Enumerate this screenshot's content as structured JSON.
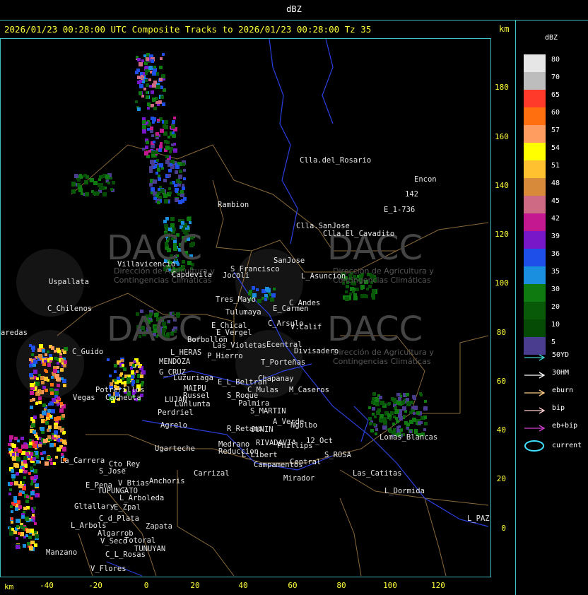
{
  "window": {
    "title": "dBZ"
  },
  "header": {
    "title": "2026/01/23 00:28:00 UTC Composite Tracks to 2026/01/23 00:28:00 Tz 35",
    "units_right": "km"
  },
  "map": {
    "x_axis_unit": "km",
    "x_ticks": [
      "-40",
      "-20",
      "0",
      "20",
      "40",
      "60",
      "80",
      "100",
      "120"
    ],
    "y_ticks": [
      "180",
      "160",
      "140",
      "120",
      "100",
      "80",
      "60",
      "40",
      "20",
      "0"
    ],
    "watermark": "DACC",
    "watermark_sub": "Dirección de Agricultura y Contingencias Climáticas",
    "places": [
      "Clla.del_Rosario",
      "Encon",
      "142",
      "E_1-736",
      "Rambion",
      "Clla.SanJose",
      "Clla.El_Cavadito",
      "S_Francisco",
      "SanJose",
      "L_Asuncion",
      "Uspallata",
      "Villavicencio",
      "Capdevila",
      "Jocoli",
      "Tres_Mayo",
      "Tulumaya",
      "E_Carmen",
      "C_Andes",
      "C_Chilenos",
      "E_Chical",
      "E_Vergel",
      "C_Arsulo",
      "V.Calif",
      "Borbollon",
      "Ecentral",
      "Divisadero",
      "L_HERAS",
      "P_Hierro",
      "Las_Violetas",
      "T_Porteñas",
      "C_Guido",
      "MENDOZA",
      "G_CRUZ",
      "Luzuriaga",
      "E_L_Beltran",
      "Chapanay",
      "MAIPU",
      "C_Mulas",
      "M_Caseros",
      "Potrerillos",
      "Russel",
      "S_Roque",
      "Vegas",
      "Cacheuta",
      "LUJAN",
      "Palmira",
      "Lunlunta",
      "Perdriel",
      "S_MARTIN",
      "A_Verde",
      "Agrelo",
      "R_Retamo",
      "JUNIN",
      "Ngolbo",
      "Lomas_Blancas",
      "Ugarteche",
      "Medrano",
      "RIVADAVIA",
      "12_Oct",
      "Phillips",
      "Reduccion",
      "L_Libert",
      "S_ROSA",
      "La_Carrera",
      "Cto_Rey",
      "Campamentos",
      "Central",
      "S_Jose",
      "Carrizal",
      "Las_Catitas",
      "E_Pena",
      "V_Btias",
      "Anchoris",
      "Mirador",
      "TUPUNGATO",
      "L_Dormida",
      "L_Arboleda",
      "Gltallary",
      "E_Zpal",
      "C_d_Plata",
      "L_PAZ",
      "L_Arbols",
      "Zapata",
      "Algarrob",
      "V_Seco",
      "Totoral",
      "TUNUYAN",
      "Manzano",
      "C_L_Rosas",
      "V_Flores",
      "aredas"
    ]
  },
  "legend": {
    "title": "dBZ",
    "levels": [
      {
        "value": "80",
        "color": "#e6e6e6"
      },
      {
        "value": "70",
        "color": "#bdbdbd"
      },
      {
        "value": "65",
        "color": "#ff3a2a"
      },
      {
        "value": "60",
        "color": "#ff6f10"
      },
      {
        "value": "57",
        "color": "#ff9d60"
      },
      {
        "value": "54",
        "color": "#ffff00"
      },
      {
        "value": "51",
        "color": "#ffc12f"
      },
      {
        "value": "48",
        "color": "#d68a3a"
      },
      {
        "value": "45",
        "color": "#cf6a84"
      },
      {
        "value": "42",
        "color": "#c41890"
      },
      {
        "value": "39",
        "color": "#7817c8"
      },
      {
        "value": "36",
        "color": "#1e4fe8"
      },
      {
        "value": "35",
        "color": "#1a8fe0"
      },
      {
        "value": "30",
        "color": "#0f7a0f"
      },
      {
        "value": "20",
        "color": "#085a08"
      },
      {
        "value": "10",
        "color": "#054a05"
      },
      {
        "value": "5",
        "color": "#4a3d8f"
      }
    ],
    "tracks": [
      {
        "label": "50YD",
        "color": "#3fd0d0"
      },
      {
        "label": "30HM",
        "color": "#ffffff"
      },
      {
        "label": "eburn",
        "color": "#ffcc88"
      },
      {
        "label": "bip",
        "color": "#ffd0d0"
      },
      {
        "label": "eb+bip",
        "color": "#d040d0"
      },
      {
        "label": "current",
        "color": "#3fe0ff"
      }
    ]
  }
}
